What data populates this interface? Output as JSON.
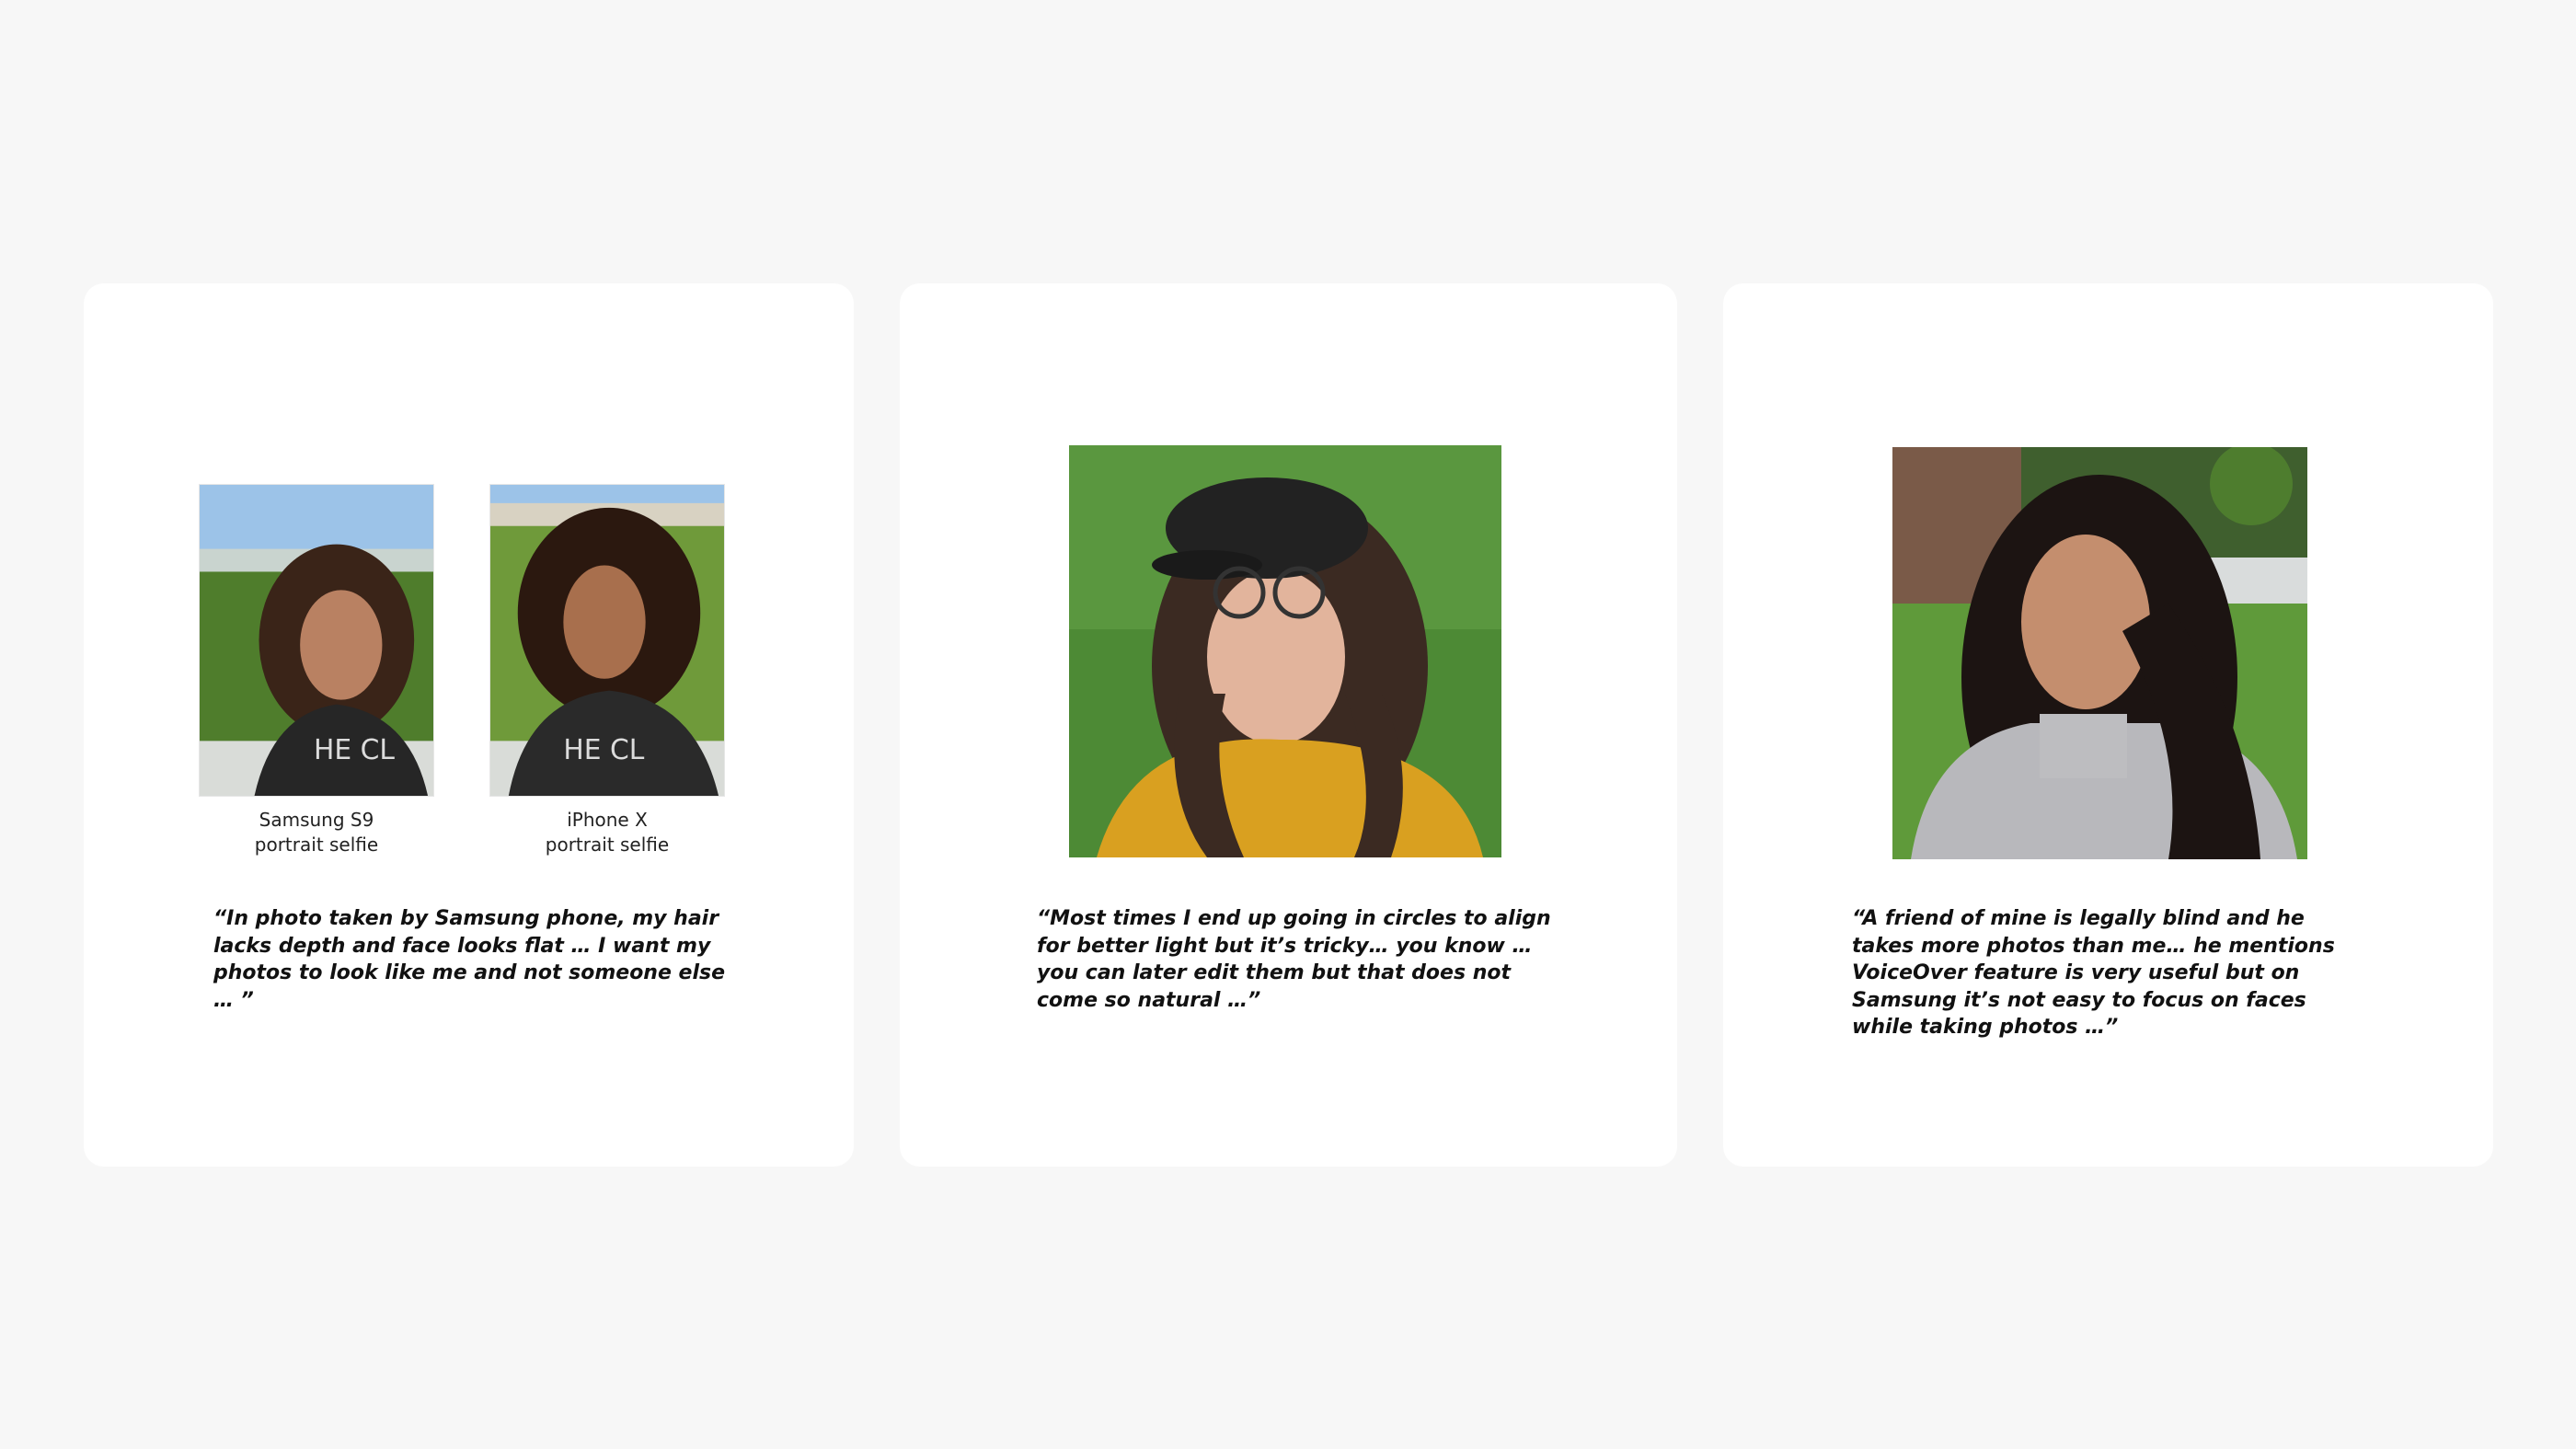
{
  "cards": [
    {
      "photos": [
        {
          "alt": "woman with curly hair taking selfie outdoors",
          "caption_line1": "Samsung S9",
          "caption_line2": "portrait selfie"
        },
        {
          "alt": "woman with curly hair taking selfie outdoors",
          "caption_line1": "iPhone X",
          "caption_line2": "portrait selfie"
        }
      ],
      "quote": "“In photo taken by Samsung phone, my hair lacks depth and face looks flat … I want my photos to look like me and not someone else … ”"
    },
    {
      "photos": [
        {
          "alt": "woman with glasses and black cap in park"
        }
      ],
      "quote": "“Most times I end up going in circles to align for better light but it’s tricky… you know …  you can later edit them but that does not come so natural …”"
    },
    {
      "photos": [
        {
          "alt": "woman with long dark hair speaking in park"
        }
      ],
      "quote": "“A friend of mine is legally blind and he takes more photos than me… he mentions VoiceOver feature is very useful but on Samsung it’s not easy to focus on faces while taking photos …”"
    }
  ],
  "colors": {
    "page_bg": "#f7f7f7",
    "card_bg": "#ffffff",
    "text": "#111111"
  }
}
